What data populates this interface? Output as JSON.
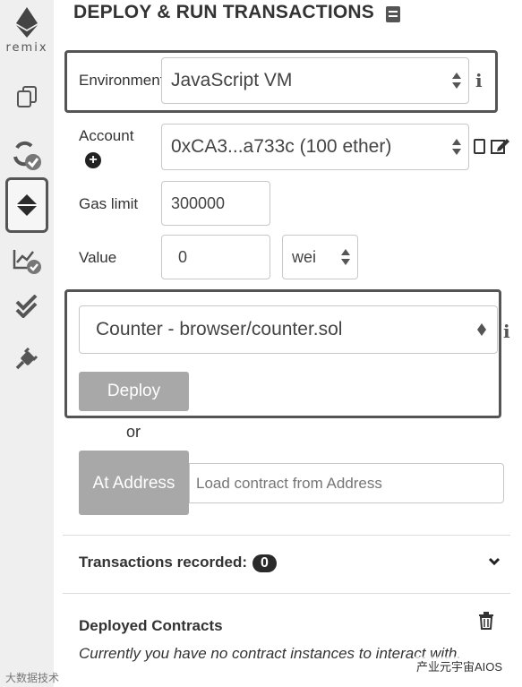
{
  "sidebar": {
    "logo_text": "remix",
    "icons": [
      "file-manager-icon",
      "compile-check-icon",
      "deploy-run-icon",
      "analysis-check-icon",
      "verify-icon",
      "plugin-icon"
    ],
    "active": "deploy-run-icon"
  },
  "header": {
    "title": "DEPLOY & RUN TRANSACTIONS",
    "doc_icon": "book-icon"
  },
  "environment": {
    "label": "Environment",
    "value": "JavaScript VM"
  },
  "account": {
    "label": "Account",
    "value": "0xCA3...a733c (100 ether)"
  },
  "gas_limit": {
    "label": "Gas limit",
    "value": "300000"
  },
  "value": {
    "label": "Value",
    "amount": "0",
    "unit": "wei"
  },
  "contract": {
    "selected": "Counter - browser/counter.sol",
    "deploy_label": "Deploy"
  },
  "or_text": "or",
  "at_address": {
    "button_label": "At Address",
    "placeholder": "Load contract from Address"
  },
  "transactions": {
    "label": "Transactions recorded:",
    "count": "0"
  },
  "deployed": {
    "title": "Deployed Contracts",
    "message": "Currently you have no contract instances to interact with."
  },
  "watermarks": {
    "left": "大数据技术",
    "right": "产业元宇宙AIOS"
  }
}
